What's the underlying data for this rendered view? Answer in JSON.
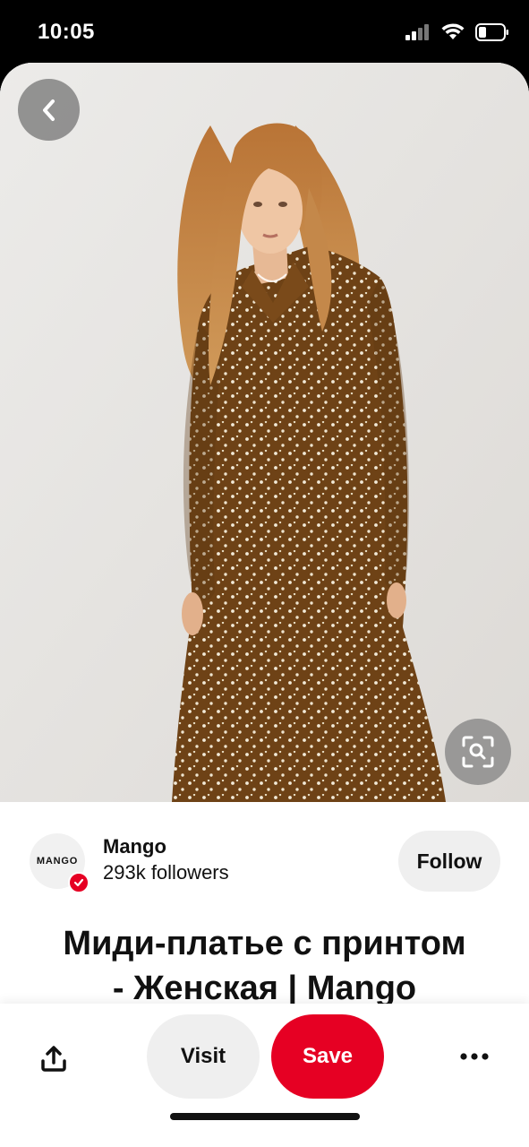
{
  "status_bar": {
    "time": "10:05",
    "icons": [
      "signal-icon",
      "wifi-icon",
      "battery-icon"
    ]
  },
  "pin": {
    "image_subject": "model in brown polka-dot midi dress",
    "back_icon": "chevron-left-icon",
    "lens_icon": "visual-search-icon",
    "title": "Миди-платье с принтом\n-  Женская | Mango"
  },
  "creator": {
    "avatar_text": "MANGO",
    "name": "Mango",
    "followers": "293k followers",
    "follow_label": "Follow"
  },
  "actions": {
    "share_icon": "share-icon",
    "visit_label": "Visit",
    "save_label": "Save",
    "more_icon": "more-icon"
  },
  "colors": {
    "brand_red": "#e60023",
    "button_gray": "#efefef",
    "dress_brown": "#6e4216"
  }
}
